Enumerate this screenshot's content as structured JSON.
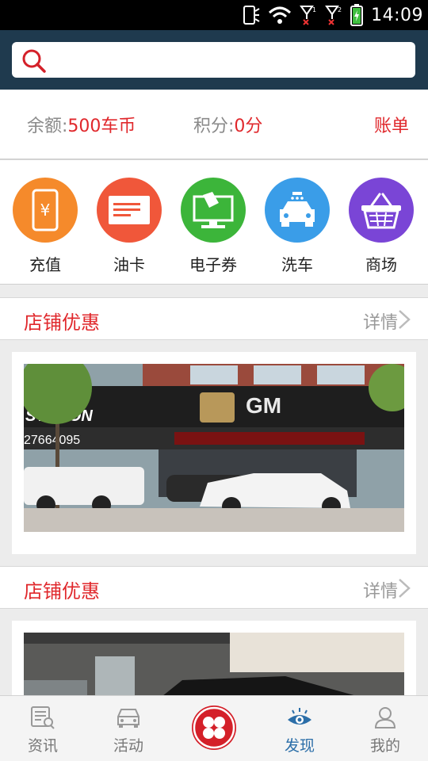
{
  "status_bar": {
    "time": "14:09",
    "sim1": "1",
    "sim2": "2"
  },
  "search": {
    "placeholder": ""
  },
  "account": {
    "balance_label": "余额:",
    "balance_value": "500车币",
    "points_label": "积分:",
    "points_value": "0分",
    "bill_label": "账单"
  },
  "quick_menu": [
    {
      "label": "充值",
      "icon": "phone-yen-icon",
      "color": "#f58a2b"
    },
    {
      "label": "油卡",
      "icon": "card-icon",
      "color": "#f0573a"
    },
    {
      "label": "电子券",
      "icon": "monitor-icon",
      "color": "#3cb53a"
    },
    {
      "label": "洗车",
      "icon": "car-wash-icon",
      "color": "#3a9de8"
    },
    {
      "label": "商场",
      "icon": "basket-icon",
      "color": "#7a45d6"
    }
  ],
  "sections": [
    {
      "title": "店铺优惠",
      "more": "详情"
    },
    {
      "title": "店铺优惠",
      "more": "详情"
    }
  ],
  "banner": {
    "brand_text": "GM",
    "station_text": "STATION",
    "phone_text": "27664095"
  },
  "tabs": [
    {
      "label": "资讯",
      "icon": "news-icon"
    },
    {
      "label": "活动",
      "icon": "car-icon"
    },
    {
      "label": "",
      "icon": "grid-circle-icon"
    },
    {
      "label": "发现",
      "icon": "eye-icon"
    },
    {
      "label": "我的",
      "icon": "person-icon"
    }
  ],
  "colors": {
    "accent": "#e0282c",
    "header": "#1f3a4e",
    "active_tab": "#2b6ea8"
  }
}
